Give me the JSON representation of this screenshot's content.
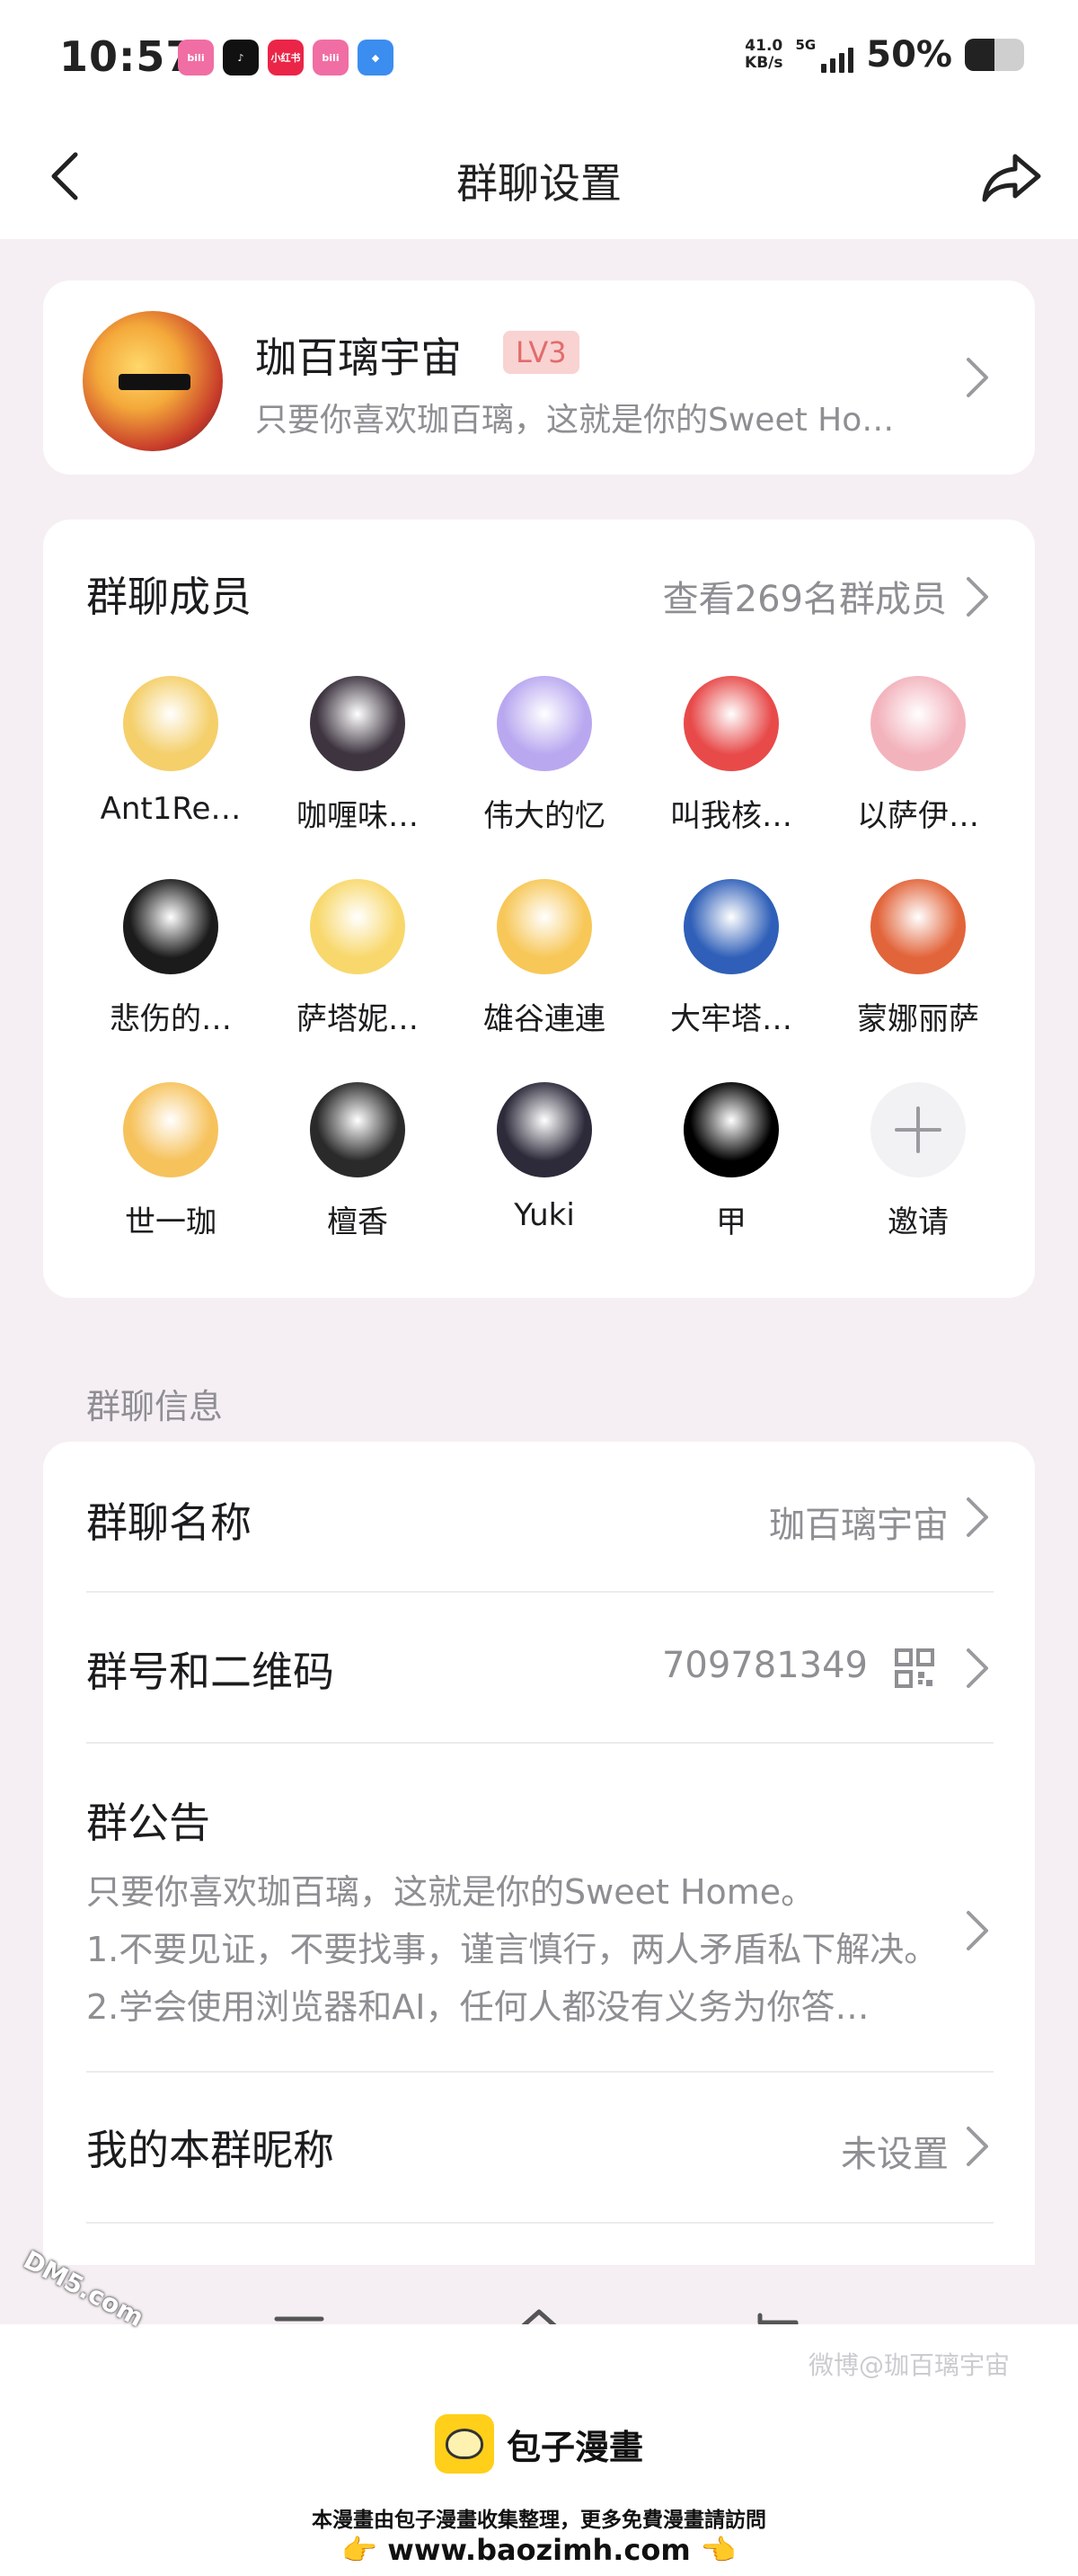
{
  "status_bar": {
    "time": "10:57",
    "apps": [
      {
        "name": "bilibili-app-icon",
        "label": "bili",
        "color": "#f06ea4"
      },
      {
        "name": "tiktok-app-icon",
        "label": "♪",
        "color": "#111111"
      },
      {
        "name": "xiaohongshu-app-icon",
        "label": "小红书",
        "color": "#ea2548"
      },
      {
        "name": "bilibili-app-icon-2",
        "label": "bili",
        "color": "#f06ea4"
      },
      {
        "name": "blue-app-icon",
        "label": "◆",
        "color": "#3b8df0"
      }
    ],
    "speed_value": "41.0",
    "speed_unit": "KB/s",
    "network": "5G",
    "battery": "50%",
    "battery_level": 0.5
  },
  "nav": {
    "title": "群聊设置"
  },
  "group": {
    "name": "珈百璃宇宙",
    "level": "LV3",
    "description": "只要你喜欢珈百璃，这就是你的Sweet Ho…"
  },
  "members": {
    "title": "群聊成员",
    "view_all": "查看269名群成员",
    "list": [
      {
        "name": "Ant1Re…",
        "color": "#f4cf6a"
      },
      {
        "name": "咖喱味…",
        "color": "#3d3440"
      },
      {
        "name": "伟大的忆",
        "color": "#b9a8f0"
      },
      {
        "name": "叫我核…",
        "color": "#e84a4a"
      },
      {
        "name": "以萨伊…",
        "color": "#f3b3bd"
      },
      {
        "name": "悲伤的…",
        "color": "#1b1b1b"
      },
      {
        "name": "萨塔妮…",
        "color": "#f8d86c"
      },
      {
        "name": "雄谷連連",
        "color": "#f7c758"
      },
      {
        "name": "大牢塔…",
        "color": "#2f5fb8"
      },
      {
        "name": "蒙娜丽萨",
        "color": "#e2643a"
      },
      {
        "name": "世一珈",
        "color": "#f6c25c"
      },
      {
        "name": "檀香",
        "color": "#2a2a2a"
      },
      {
        "name": "Yuki",
        "color": "#2d2a3a"
      },
      {
        "name": "甲",
        "color": "#000000"
      }
    ],
    "invite_label": "邀请"
  },
  "info_section": {
    "label": "群聊信息",
    "group_name_label": "群聊名称",
    "group_name_value": "珈百璃宇宙",
    "group_id_label": "群号和二维码",
    "group_id_value": "709781349",
    "notice_label": "群公告",
    "notice_lines": [
      "只要你喜欢珈百璃，这就是你的Sweet Home。",
      "1.不要见证，不要找事，谨言慎行，两人矛盾私下解决。",
      "2.学会使用浏览器和AI，任何人都没有义务为你答…"
    ],
    "nickname_label": "我的本群昵称",
    "nickname_value": "未设置"
  },
  "footer": {
    "logo_text": "包子漫畫",
    "line": "本漫畫由包子漫畫收集整理，更多免費漫畫請訪問",
    "url": "👉 www.baozimh.com 👈"
  },
  "watermarks": {
    "left": "DM5.com",
    "right": "微博@珈百璃宇宙"
  }
}
